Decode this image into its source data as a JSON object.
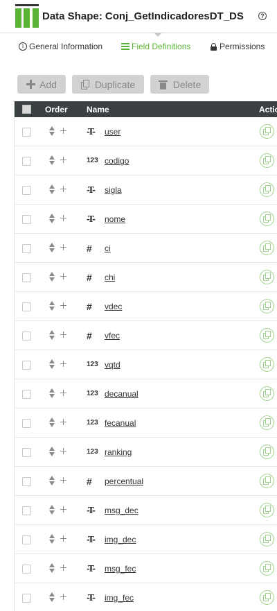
{
  "header": {
    "title": "Data Shape: Conj_GetIndicadoresDT_DS",
    "help_glyph": "?"
  },
  "tabs": [
    {
      "label": "General Information",
      "icon": "info-icon",
      "active": false
    },
    {
      "label": "Field Definitions",
      "icon": "list-icon",
      "active": true
    },
    {
      "label": "Permissions",
      "icon": "lock-icon",
      "active": false
    }
  ],
  "toolbar": {
    "add_label": "Add",
    "duplicate_label": "Duplicate",
    "delete_label": "Delete"
  },
  "table": {
    "columns": {
      "order": "Order",
      "name": "Name",
      "actions": "Actio"
    },
    "rows": [
      {
        "name": "user",
        "type_icon": "-T-"
      },
      {
        "name": "codigo",
        "type_icon": "123"
      },
      {
        "name": "sigla",
        "type_icon": "-T-"
      },
      {
        "name": "nome",
        "type_icon": "-T-"
      },
      {
        "name": "ci",
        "type_icon": "#"
      },
      {
        "name": "chi",
        "type_icon": "#"
      },
      {
        "name": "vdec",
        "type_icon": "#"
      },
      {
        "name": "vfec",
        "type_icon": "#"
      },
      {
        "name": "vqtd",
        "type_icon": "123"
      },
      {
        "name": "decanual",
        "type_icon": "123"
      },
      {
        "name": "fecanual",
        "type_icon": "123"
      },
      {
        "name": "ranking",
        "type_icon": "123"
      },
      {
        "name": "percentual",
        "type_icon": "#"
      },
      {
        "name": "msg_dec",
        "type_icon": "-T-"
      },
      {
        "name": "img_dec",
        "type_icon": "-T-"
      },
      {
        "name": "msg_fec",
        "type_icon": "-T-"
      },
      {
        "name": "img_fec",
        "type_icon": "-T-"
      }
    ]
  },
  "colors": {
    "accent": "#5bb335",
    "header_bg": "#3b4042",
    "button_bg": "#d2d2d2"
  }
}
